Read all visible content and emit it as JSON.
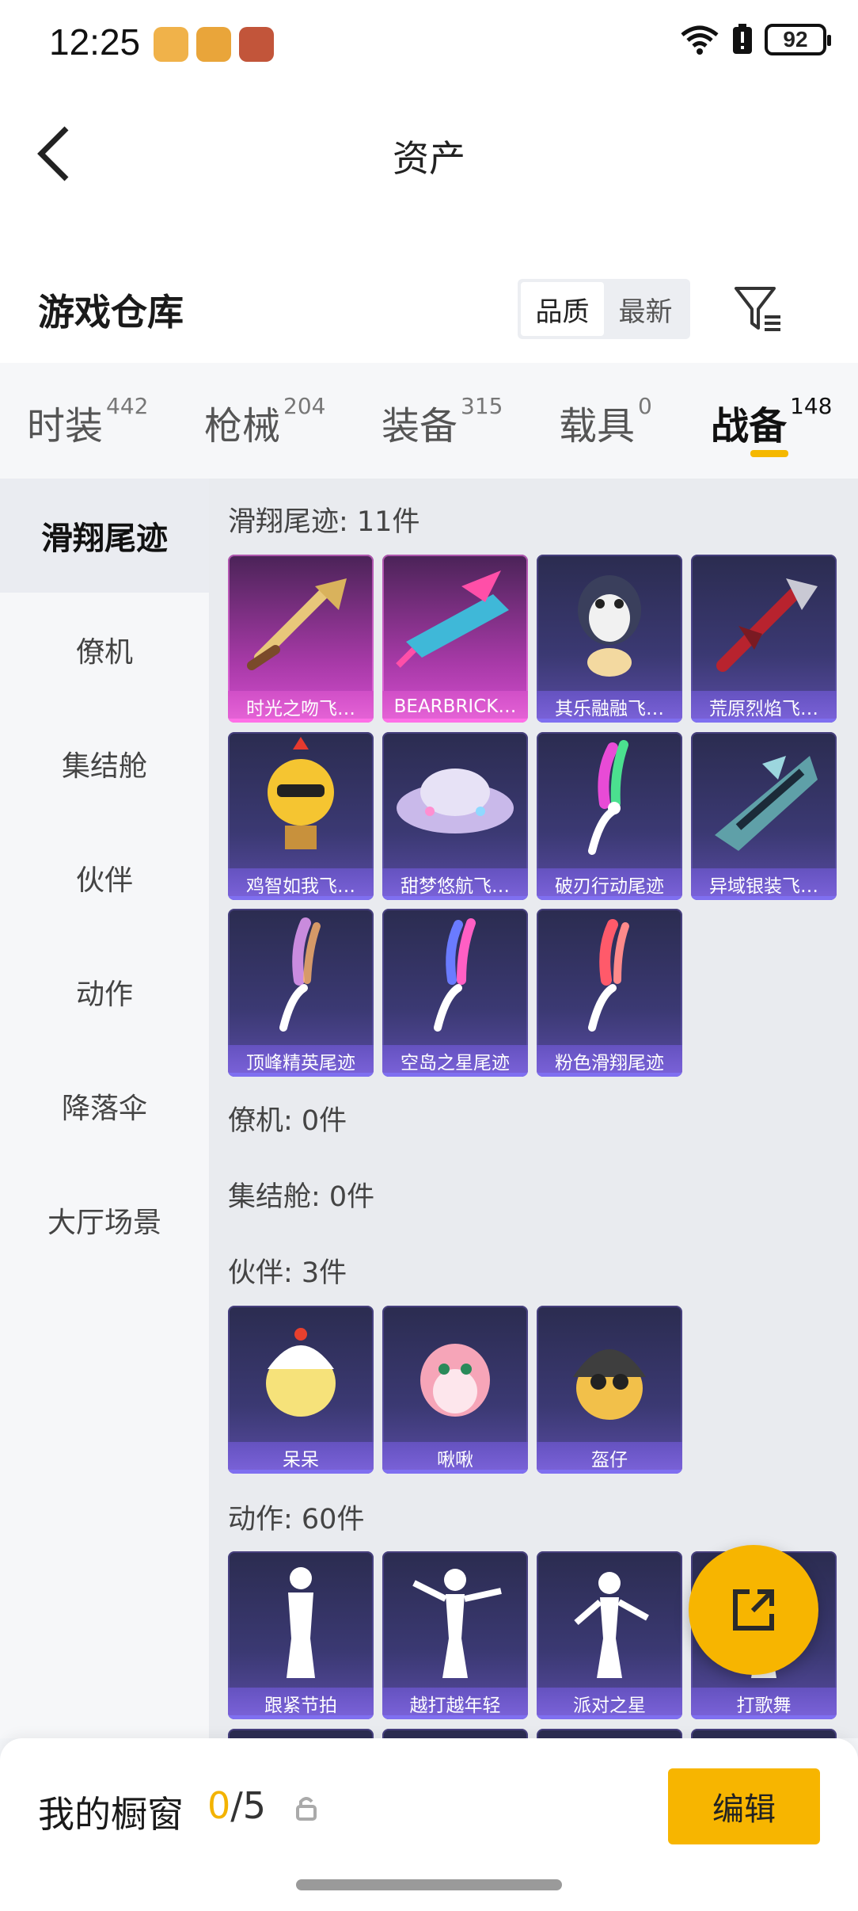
{
  "status_bar": {
    "time": "12:25",
    "battery": "92",
    "icons": [
      "wifi-icon",
      "battery-alert-icon"
    ]
  },
  "nav": {
    "title": "资产",
    "back_icon": "chevron-left-icon"
  },
  "header": {
    "title": "游戏仓库",
    "sort_options": [
      {
        "label": "品质",
        "selected": true
      },
      {
        "label": "最新",
        "selected": false
      }
    ],
    "filter_icon": "filter-icon"
  },
  "tabs": [
    {
      "label": "时装",
      "count": "442",
      "active": false
    },
    {
      "label": "枪械",
      "count": "204",
      "active": false
    },
    {
      "label": "装备",
      "count": "315",
      "active": false
    },
    {
      "label": "载具",
      "count": "0",
      "active": false
    },
    {
      "label": "战备",
      "count": "148",
      "active": true
    }
  ],
  "sidebar": {
    "items": [
      {
        "label": "滑翔尾迹",
        "active": true
      },
      {
        "label": "僚机",
        "active": false
      },
      {
        "label": "集结舱",
        "active": false
      },
      {
        "label": "伙伴",
        "active": false
      },
      {
        "label": "动作",
        "active": false
      },
      {
        "label": "降落伞",
        "active": false
      },
      {
        "label": "大厅场景",
        "active": false
      }
    ]
  },
  "sections": {
    "glide_trail": {
      "title": "滑翔尾迹: 11件",
      "items": [
        {
          "name": "时光之吻飞…",
          "rarity": "pink"
        },
        {
          "name": "BEARBRICK…",
          "rarity": "pink"
        },
        {
          "name": "其乐融融飞…",
          "rarity": "purple"
        },
        {
          "name": "荒原烈焰飞…",
          "rarity": "purple"
        },
        {
          "name": "鸡智如我飞…",
          "rarity": "purple"
        },
        {
          "name": "甜梦悠航飞…",
          "rarity": "purple"
        },
        {
          "name": "破刃行动尾迹",
          "rarity": "purple"
        },
        {
          "name": "异域银装飞…",
          "rarity": "purple"
        },
        {
          "name": "顶峰精英尾迹",
          "rarity": "purple"
        },
        {
          "name": "空岛之星尾迹",
          "rarity": "purple"
        },
        {
          "name": "粉色滑翔尾迹",
          "rarity": "purple"
        }
      ]
    },
    "wingman": {
      "title": "僚机: 0件"
    },
    "rally_pod": {
      "title": "集结舱: 0件"
    },
    "companion": {
      "title": "伙伴: 3件",
      "items": [
        {
          "name": "呆呆"
        },
        {
          "name": "啾啾"
        },
        {
          "name": "盔仔"
        }
      ]
    },
    "emote": {
      "title": "动作: 60件",
      "items": [
        {
          "name": "跟紧节拍"
        },
        {
          "name": "越打越年轻"
        },
        {
          "name": "派对之星"
        },
        {
          "name": "打歌舞"
        }
      ]
    }
  },
  "fab": {
    "icon": "share-external-icon"
  },
  "bottom_bar": {
    "title": "我的橱窗",
    "current": "0",
    "total": "/5",
    "lock_icon": "lock-icon",
    "edit_label": "编辑"
  },
  "colors": {
    "accent": "#f7b500",
    "card_purple": "#3b3973",
    "card_pink": "#c044bf"
  }
}
